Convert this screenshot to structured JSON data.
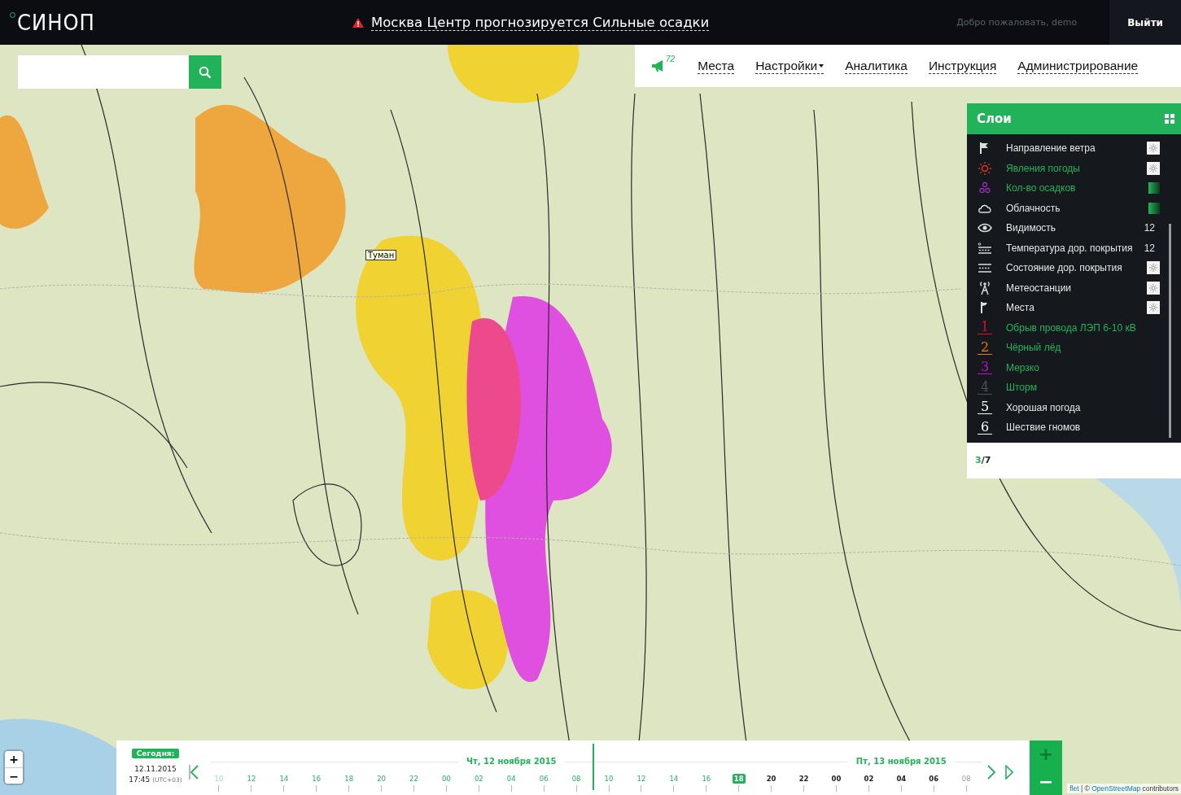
{
  "header": {
    "logo": "СИНОП",
    "alert": "Москва Центр прогнозируется Сильные осадки",
    "welcome": "Добро пожаловать, demo",
    "logout": "Выйти"
  },
  "nav": {
    "notifications": "72",
    "items": [
      {
        "label": "Места",
        "dropdown": false
      },
      {
        "label": "Настройки",
        "dropdown": true
      },
      {
        "label": "Аналитика",
        "dropdown": false
      },
      {
        "label": "Инструкция",
        "dropdown": false
      },
      {
        "label": "Администрирование",
        "dropdown": false
      }
    ]
  },
  "map": {
    "tooltip": "Туман"
  },
  "layers": {
    "title": "Слои",
    "items": [
      {
        "kind": "settings",
        "label": "Направление ветра",
        "active": false
      },
      {
        "kind": "settings",
        "label": "Явления погоды",
        "active": true
      },
      {
        "kind": "scale",
        "label": "Кол-во осадков",
        "active": true
      },
      {
        "kind": "scale",
        "label": "Облачность",
        "active": false
      },
      {
        "kind": "value",
        "label": "Видимость",
        "active": false,
        "value": "12"
      },
      {
        "kind": "value",
        "label": "Температура дор. покрытия",
        "active": false,
        "value": "12"
      },
      {
        "kind": "settings",
        "label": "Состояние дор. покрытия",
        "active": false
      },
      {
        "kind": "settings",
        "label": "Метеостанции",
        "active": false
      },
      {
        "kind": "settings",
        "label": "Места",
        "active": false
      },
      {
        "kind": "number",
        "number": "1",
        "color": "#e0141e",
        "label": "Обрыв провода ЛЭП 6-10 кВ",
        "active": true
      },
      {
        "kind": "number",
        "number": "2",
        "color": "#f07800",
        "label": "Чёрный лёд",
        "active": true
      },
      {
        "kind": "number",
        "number": "3",
        "color": "#b414d2",
        "label": "Мерзко",
        "active": true
      },
      {
        "kind": "number",
        "number": "4",
        "color": "#505050",
        "label": "Шторм",
        "active": true
      },
      {
        "kind": "number",
        "number": "5",
        "color": "#ffffff",
        "label": "Хорошая погода",
        "active": false
      },
      {
        "kind": "number",
        "number": "6",
        "color": "#ffffff",
        "label": "Шествие гномов",
        "active": false
      }
    ],
    "active_count": "3",
    "total": "/7"
  },
  "timeline": {
    "today_label": "Сегодня:",
    "date": "12.11.2015",
    "time": "17:45",
    "timezone": "(UTC+03)",
    "ticks": [
      {
        "label": "10",
        "kind": "faded"
      },
      {
        "label": "12",
        "kind": "past"
      },
      {
        "label": "14",
        "kind": "past"
      },
      {
        "label": "16",
        "kind": "past"
      },
      {
        "label": "18",
        "kind": "past"
      },
      {
        "label": "20",
        "kind": "past"
      },
      {
        "label": "22",
        "kind": "past"
      },
      {
        "label": "00",
        "kind": "past"
      },
      {
        "label": "02",
        "kind": "past"
      },
      {
        "label": "04",
        "kind": "past",
        "day": "Чт, 12 ноября 2015"
      },
      {
        "label": "06",
        "kind": "past"
      },
      {
        "label": "08",
        "kind": "past",
        "now": true
      },
      {
        "label": "10",
        "kind": "past"
      },
      {
        "label": "12",
        "kind": "past"
      },
      {
        "label": "14",
        "kind": "past"
      },
      {
        "label": "16",
        "kind": "past"
      },
      {
        "label": "18",
        "kind": "current"
      },
      {
        "label": "20",
        "kind": "future"
      },
      {
        "label": "22",
        "kind": "future"
      },
      {
        "label": "00",
        "kind": "future"
      },
      {
        "label": "02",
        "kind": "future"
      },
      {
        "label": "04",
        "kind": "future",
        "day": "Пт, 13 ноября 2015"
      },
      {
        "label": "06",
        "kind": "future"
      },
      {
        "label": "08",
        "kind": "far"
      }
    ]
  },
  "map_zoom": {
    "in": "+",
    "out": "−"
  },
  "time_zoom": {
    "in": "+",
    "out": "−"
  },
  "attribution": {
    "prefix": "flet",
    "separator": "| ©",
    "link": "OpenStreetMap",
    "suffix": "contributors"
  }
}
